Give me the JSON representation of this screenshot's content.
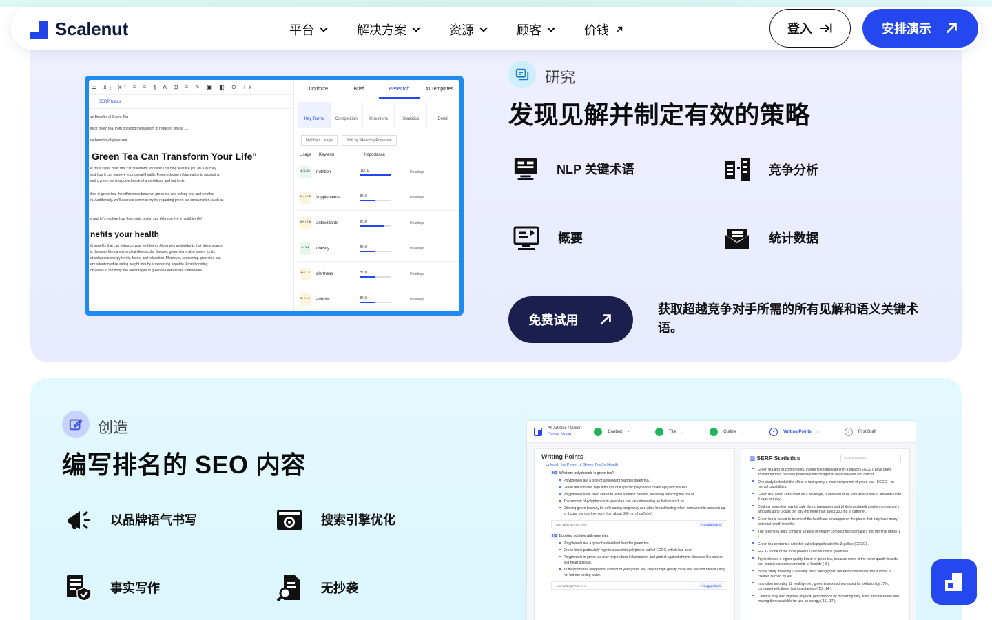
{
  "brand": {
    "name": "Scalenut",
    "accent": "#2447f0",
    "navy": "#1b1f4d"
  },
  "nav": {
    "items": [
      {
        "label": "平台",
        "icon": "chevron-down-icon"
      },
      {
        "label": "解决方案",
        "icon": "chevron-down-icon"
      },
      {
        "label": "资源",
        "icon": "chevron-down-icon"
      },
      {
        "label": "顾客",
        "icon": "chevron-down-icon"
      },
      {
        "label": "价钱",
        "icon": "arrow-up-right-icon"
      }
    ],
    "login_label": "登入",
    "demo_label": "安排演示"
  },
  "research": {
    "label": "研究",
    "title": "发现见解并制定有效的策略",
    "features": [
      {
        "label": "NLP 关键术语",
        "icon": "nlp-terms-icon"
      },
      {
        "label": "竞争分析",
        "icon": "competition-icon"
      },
      {
        "label": "概要",
        "icon": "outline-icon"
      },
      {
        "label": "统计数据",
        "icon": "statistics-icon"
      }
    ],
    "cta_label": "免费试用",
    "cta_desc": "获取超越竞争对手所需的所有见解和语义关键术语。",
    "mock": {
      "serp_ideas": "SERP Ideas",
      "lines_top": [
        "ve Benefits of Green Tea",
        "its of green tea, from boosting metabolism to reducing stress. L...",
        "ve-benefits-of-green-tea"
      ],
      "h1": "Green Tea Can Transform Your Life\"",
      "para1": [
        "k; It's a super drink that can transform your life! This blog will take you on a journey",
        "and how it can improve your overall health. From reducing inflammation to promoting",
        "ealth, green tea is a powerhouse of antioxidants and nutrients."
      ],
      "para2": [
        "ition in green tea, the differences between green tea and oolong tea, and whether",
        "rk. Additionally, we'll address common myths regarding green tea consumption, such as"
      ],
      "para3": [
        "e and let's explore how this magic potion can help you live a healthier life!"
      ],
      "h2": "nefits your health",
      "para4": [
        "th benefits that can enhance your well-being. Along with antioxidants that shield against",
        "ic diseases like cancer and cardiovascular disease, green tea is also known for its",
        "at enhances energy levels, focus, and relaxation. Moreover, consuming green tea can",
        "ery retention while aiding weight loss by suppressing appetite. From boosting",
        "on levels in the body, the advantages of green tea extract are unmissable."
      ],
      "tabs": [
        "Optimize",
        "Brief",
        "Research",
        "AI Templates"
      ],
      "active_tab": "Research",
      "subtabs": [
        "Key Terms",
        "Competition",
        "Questions",
        "Statistics",
        "Detail"
      ],
      "active_subtab": "Key Terms",
      "highlight_label": "Highlight Usage",
      "sort_label": "Sort by: Heading Presence",
      "columns": [
        "Usage",
        "Keyterm",
        "Importance"
      ],
      "rows": [
        {
          "usage": "4 / 1-10",
          "term": "nutrition",
          "score": "10/10",
          "value": 10,
          "color": "#e6f7ec",
          "tag": "Headings"
        },
        {
          "usage": "10+ / 2-6",
          "term": "supplements",
          "score": "5/10",
          "value": 5,
          "color": "#fff4dc",
          "tag": "Headings"
        },
        {
          "usage": "10+ / 2-6",
          "term": "antioxidants",
          "score": "8/10",
          "value": 8,
          "color": "#fff4dc",
          "tag": "Headings"
        },
        {
          "usage": "3 / 1-2",
          "term": "obesity",
          "score": "5/10",
          "value": 5,
          "color": "#e6f7ec",
          "tag": "Headings"
        },
        {
          "usage": "4+ / 1-2",
          "term": "alertness",
          "score": "5/10",
          "value": 5,
          "color": "#fff4dc",
          "tag": "Headings"
        },
        {
          "usage": "8+ / 1-2",
          "term": "arthritis",
          "score": "5/10",
          "value": 5,
          "color": "#fff4dc",
          "tag": "Headings"
        }
      ]
    }
  },
  "create": {
    "label": "创造",
    "title": "编写排名的 SEO 内容",
    "features": [
      {
        "label": "以品牌语气书写",
        "icon": "megaphone-icon"
      },
      {
        "label": "搜索引擎优化",
        "icon": "seo-gear-icon"
      },
      {
        "label": "事实写作",
        "icon": "fact-check-icon"
      },
      {
        "label": "无抄袭",
        "icon": "plagiarism-search-icon"
      }
    ],
    "mock": {
      "breadcrumb": "All Articles / Green",
      "mode": "Cruise Mode",
      "steps": [
        "Context",
        "Title",
        "Outline",
        "Writing Points",
        "First Draft"
      ],
      "active_step": "Writing Points",
      "writing_title": "Writing Points",
      "writing_sub": "Unleash the Power of Green Tea for Health",
      "h2_a": "What are polyphenols in green tea?",
      "bullets_a": [
        "Polyphenols are a type of antioxidant found in green tea.",
        "Green tea contains high amounts of a specific polyphenol called epigallocatechin",
        "Polyphenols have been linked to various health benefits, including reducing the risk of",
        "The amount of polyphenols in green tea can vary depending on factors such as",
        "Drinking green tea may be safe during pregnancy and while breastfeeding when consumed in amounts up to 6 cups per day (no more than about 300 mg of caffeine)."
      ],
      "add_point": "Add Writing Point here",
      "suggestions": "+ Suggestions",
      "h3_b": "Boosting nutrition with green tea",
      "bullets_b": [
        "Polyphenols are a type of antioxidant found in green tea.",
        "Green tea is particularly high in a catechin polyphenol called EGCG, which has been",
        "Polyphenols in green tea may help reduce inflammation and protect against chronic diseases like cancer and heart disease.",
        "To maximize the polyphenol content of your green tea, choose high-quality loose leaf tea and brew it using hot but not boiling water."
      ],
      "serp_title": "SERP Statistics",
      "search_placeholder": "Search Statistics",
      "stats": [
        "Green tea and its components, including epigallocatechin-3-gallate (EGCG), have been studied for their possible protective effects against heart disease and cancer.",
        "One study looked at the effect of taking only a main component of green tea—EGCG—on mental capabilities.",
        "Green tea, when consumed as a beverage, is believed to be safe when used in amounts up to 8 cups per day.",
        "Drinking green tea may be safe during pregnancy and while breastfeeding when consumed in amounts up to 6 cups per day (no more than about 300 mg of caffeine).",
        "Green tea is touted to be one of the healthiest beverages on the planet that may have many potential health benefits.",
        "The green tea plant contains a range of healthy compounds that make it into the final drink ( 1 ).",
        "Green tea contains a catechin called epigallocatechin-3-gallate (EGCG) .",
        "EGCG is one of the most powerful compounds in green tea.",
        "Try to choose a higher quality brand of green tea, because some of the lower quality brands can contain excessive amounts of fluoride ( 3 ).",
        "In one study involving 10 healthy men, taking green tea extract increased the number of calories burned by 4%.",
        "In another involving 12 healthy men, green tea extract increased fat oxidation by 17%, compared with those taking a placebo ( 13 , 14 ).",
        "Caffeine may also improve physical performance by mobilizing fatty acids from fat tissue and making them available for use as energy ( 16 , 17 )."
      ]
    }
  },
  "chat": {
    "icon": "scalenut-chat-icon"
  }
}
